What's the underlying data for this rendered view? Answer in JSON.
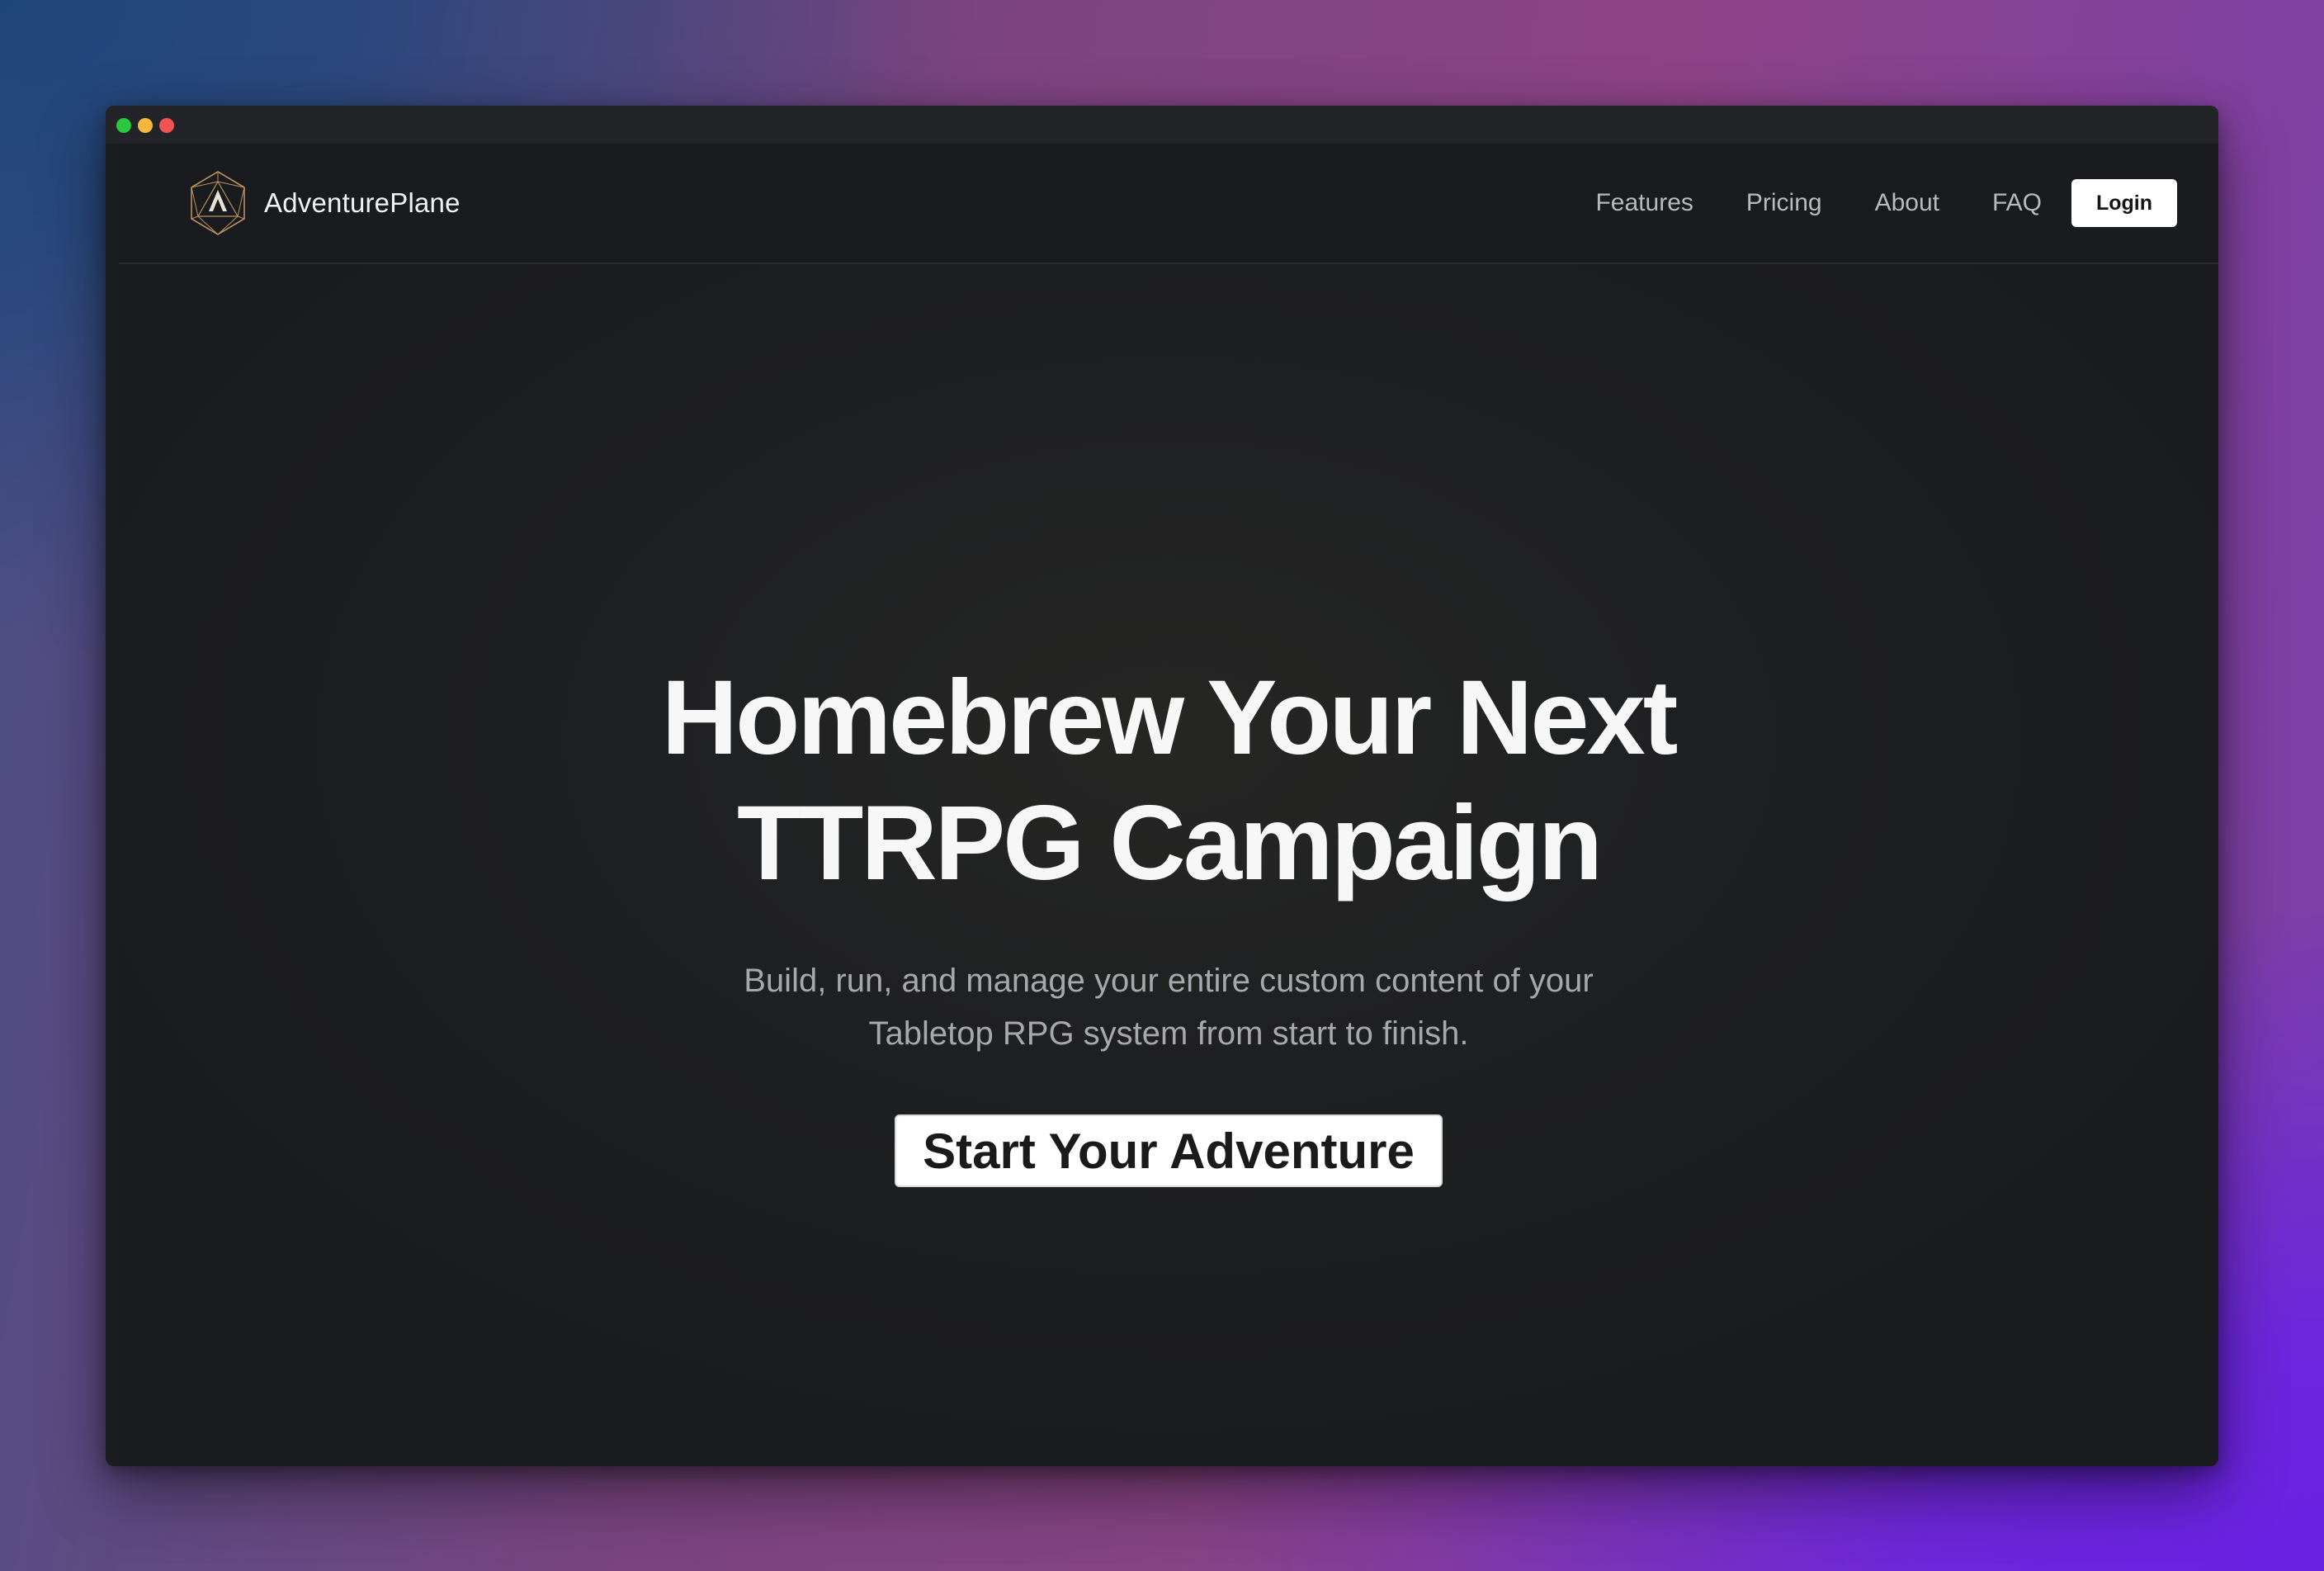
{
  "window": {
    "controls": [
      "green",
      "yellow",
      "red"
    ],
    "colors": {
      "green": "#2cc840",
      "yellow": "#f5b63a",
      "red": "#f15451"
    }
  },
  "nav": {
    "brand_name": "AdventurePlane",
    "logo_icon": "d20-logo-icon",
    "links": [
      "Features",
      "Pricing",
      "About",
      "FAQ"
    ],
    "login_label": "Login"
  },
  "hero": {
    "headline_line1": "Homebrew Your Next",
    "headline_line2": "TTRPG Campaign",
    "subtitle_line1": "Build, run, and manage your entire custom content of your",
    "subtitle_line2": "Tabletop RPG system from start to finish.",
    "cta_label": "Start Your Adventure"
  },
  "colors": {
    "accent_gold": "#b8925a",
    "background": "#1c1d20"
  }
}
